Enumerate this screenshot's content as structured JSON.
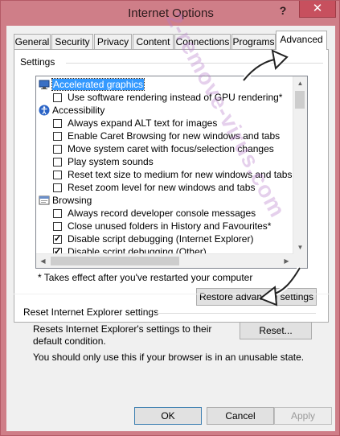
{
  "window": {
    "title": "Internet Options",
    "help_glyph": "?",
    "close_glyph": "✕"
  },
  "tabs": [
    {
      "label": "General"
    },
    {
      "label": "Security"
    },
    {
      "label": "Privacy"
    },
    {
      "label": "Content"
    },
    {
      "label": "Connections"
    },
    {
      "label": "Programs"
    },
    {
      "label": "Advanced",
      "active": true
    }
  ],
  "settings": {
    "group_label": "Settings",
    "items": [
      {
        "kind": "category",
        "label": "Accelerated graphics",
        "icon": "monitor-icon",
        "selected": true
      },
      {
        "kind": "option",
        "label": "Use software rendering instead of GPU rendering*",
        "checked": false
      },
      {
        "kind": "category",
        "label": "Accessibility",
        "icon": "accessibility-icon"
      },
      {
        "kind": "option",
        "label": "Always expand ALT text for images",
        "checked": false
      },
      {
        "kind": "option",
        "label": "Enable Caret Browsing for new windows and tabs",
        "checked": false
      },
      {
        "kind": "option",
        "label": "Move system caret with focus/selection changes",
        "checked": false
      },
      {
        "kind": "option",
        "label": "Play system sounds",
        "checked": false
      },
      {
        "kind": "option",
        "label": "Reset text size to medium for new windows and tabs",
        "checked": false
      },
      {
        "kind": "option",
        "label": "Reset zoom level for new windows and tabs",
        "checked": false
      },
      {
        "kind": "category",
        "label": "Browsing",
        "icon": "browsing-icon"
      },
      {
        "kind": "option",
        "label": "Always record developer console messages",
        "checked": false
      },
      {
        "kind": "option",
        "label": "Close unused folders in History and Favourites*",
        "checked": false
      },
      {
        "kind": "option",
        "label": "Disable script debugging (Internet Explorer)",
        "checked": true
      },
      {
        "kind": "option",
        "label": "Disable script debugging (Other)",
        "checked": true
      }
    ],
    "note": "* Takes effect after you've restarted your computer",
    "restore_button": "Restore advanced settings"
  },
  "reset": {
    "group_label": "Reset Internet Explorer settings",
    "description": "Resets Internet Explorer's settings to their default condition.",
    "reset_button": "Reset...",
    "warning": "You should only use this if your browser is in an unusable state."
  },
  "footer": {
    "ok": "OK",
    "cancel": "Cancel",
    "apply": "Apply"
  },
  "watermark": "2-remove-virus.com",
  "colors": {
    "frame": "#cf7e88",
    "selection": "#3399ff",
    "close_button": "#c7505e"
  }
}
